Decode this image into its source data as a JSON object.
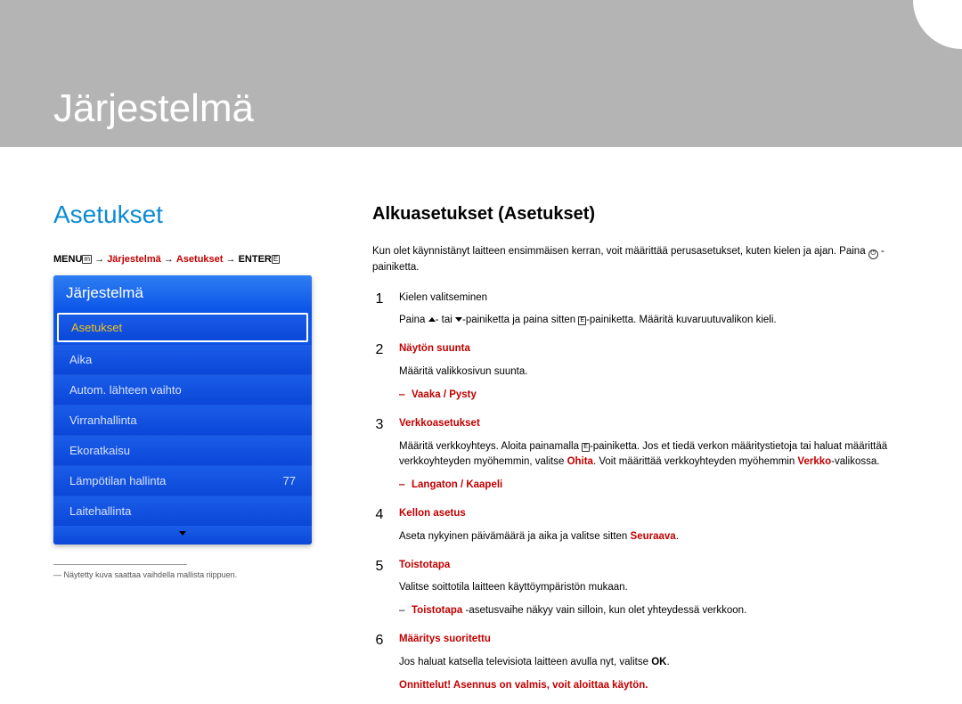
{
  "chapter_title": "Järjestelmä",
  "section_title": "Asetukset",
  "breadcrumb": {
    "prefix": "MENU",
    "arrow": "→",
    "part1": "Järjestelmä",
    "part2": "Asetukset",
    "suffix": "ENTER"
  },
  "menu": {
    "header": "Järjestelmä",
    "items": [
      {
        "label": "Asetukset",
        "selected": true
      },
      {
        "label": "Aika"
      },
      {
        "label": "Autom. lähteen vaihto"
      },
      {
        "label": "Virranhallinta"
      },
      {
        "label": "Ekoratkaisu"
      },
      {
        "label": "Lämpötilan hallinta",
        "value": "77"
      },
      {
        "label": "Laitehallinta"
      }
    ]
  },
  "footnote": "―  Näytetty kuva saattaa vaihdella mallista riippuen.",
  "subheading": "Alkuasetukset (Asetukset)",
  "intro_prefix": "Kun olet käynnistänyt laitteen ensimmäisen kerran, voit määrittää perusasetukset, kuten kielen ja ajan. Paina ",
  "intro_suffix": " -painiketta.",
  "steps": [
    {
      "n": "1",
      "lines": [
        {
          "text": "Kielen valitseminen"
        },
        {
          "rich": "paina"
        }
      ]
    },
    {
      "n": "2",
      "title": "Näytön suunta",
      "lines": [
        {
          "text": "Määritä valikkosivun suunta."
        }
      ],
      "opt": "Vaaka / Pysty"
    },
    {
      "n": "3",
      "title": "Verkkoasetukset",
      "rich": "verkko",
      "opt": "Langaton / Kaapeli"
    },
    {
      "n": "4",
      "title": "Kellon asetus",
      "rich": "kellon"
    },
    {
      "n": "5",
      "title": "Toistotapa",
      "lines": [
        {
          "text": "Valitse soittotila laitteen käyttöympäristön mukaan."
        }
      ],
      "note_prefix": "Toistotapa",
      "note_suffix": " -asetusvaihe näkyy vain silloin, kun olet yhteydessä verkkoon."
    },
    {
      "n": "6",
      "title": "Määritys suoritettu",
      "highlight_line": "Onnittelut! Asennus on valmis, voit aloittaa käytön.",
      "rich": "ok"
    }
  ],
  "rich_text": {
    "paina_prefix": "Paina ",
    "paina_mid1": "- tai ",
    "paina_mid2": "-painiketta ja paina sitten ",
    "paina_suffix": "-painiketta. Määritä kuvaruutuvalikon kieli.",
    "verkko_prefix": "Määritä verkkoyhteys. Aloita painamalla ",
    "verkko_mid": "-painiketta. Jos et tiedä verkon määritystietoja tai haluat määrittää verkkoyhteyden myöhemmin, valitse ",
    "verkko_ohita": "Ohita",
    "verkko_mid2": ". Voit määrittää verkkoyhteyden myöhemmin ",
    "verkko_verkko": "Verkko",
    "verkko_suffix": "-valikossa.",
    "kellon_prefix": "Aseta nykyinen päivämäärä ja aika ja valitse sitten ",
    "kellon_seuraava": "Seuraava",
    "kellon_suffix": ".",
    "ok_prefix": "Jos haluat katsella televisiota laitteen avulla nyt, valitse ",
    "ok_ok": "OK",
    "ok_suffix": "."
  }
}
